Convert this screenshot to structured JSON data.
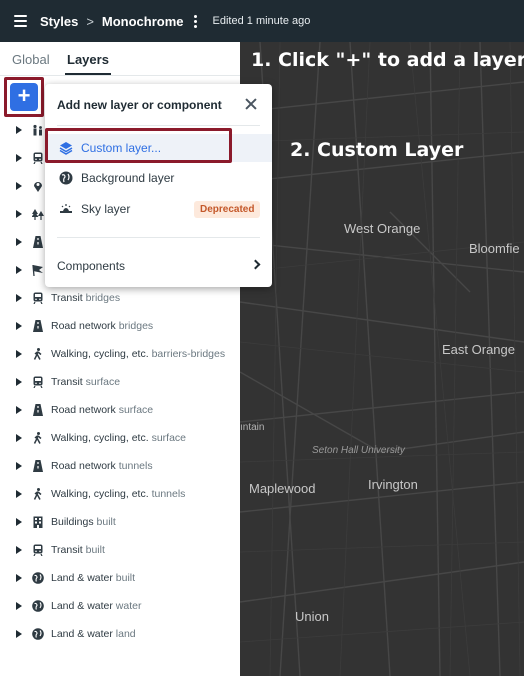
{
  "header": {
    "breadcrumb_root": "Styles",
    "breadcrumb_separator": ">",
    "style_name": "Monochrome",
    "edited_status": "Edited 1 minute ago"
  },
  "tabs": [
    {
      "label": "Global",
      "active": false
    },
    {
      "label": "Layers",
      "active": true
    }
  ],
  "add_button_label": "+",
  "layers": [
    {
      "name": "",
      "suffix": "",
      "icon": "people-icon"
    },
    {
      "name": "",
      "suffix": "",
      "icon": "transit-icon"
    },
    {
      "name": "",
      "suffix": "",
      "icon": "pin-icon"
    },
    {
      "name": "",
      "suffix": "",
      "icon": "trees-icon"
    },
    {
      "name": "",
      "suffix": "",
      "icon": "road-icon"
    },
    {
      "name": "",
      "suffix": "",
      "icon": "flag-icon"
    },
    {
      "name": "Transit",
      "suffix": "bridges",
      "icon": "transit-icon"
    },
    {
      "name": "Road network",
      "suffix": "bridges",
      "icon": "road-icon"
    },
    {
      "name": "Walking, cycling, etc.",
      "suffix": "barriers-bridges",
      "icon": "walking-icon"
    },
    {
      "name": "Transit",
      "suffix": "surface",
      "icon": "transit-icon"
    },
    {
      "name": "Road network",
      "suffix": "surface",
      "icon": "road-icon"
    },
    {
      "name": "Walking, cycling, etc.",
      "suffix": "surface",
      "icon": "walking-icon"
    },
    {
      "name": "Road network",
      "suffix": "tunnels",
      "icon": "road-icon"
    },
    {
      "name": "Walking, cycling, etc.",
      "suffix": "tunnels",
      "icon": "walking-icon"
    },
    {
      "name": "Buildings",
      "suffix": "built",
      "icon": "building-icon"
    },
    {
      "name": "Transit",
      "suffix": "built",
      "icon": "transit-icon"
    },
    {
      "name": "Land & water",
      "suffix": "built",
      "icon": "globe-icon"
    },
    {
      "name": "Land & water",
      "suffix": "water",
      "icon": "globe-icon"
    },
    {
      "name": "Land & water",
      "suffix": "land",
      "icon": "globe-icon"
    }
  ],
  "dropdown": {
    "title": "Add new layer or component",
    "items": [
      {
        "label": "Custom layer...",
        "icon": "layers-icon",
        "selected": true
      },
      {
        "label": "Background layer",
        "icon": "globe-icon",
        "selected": false
      },
      {
        "label": "Sky layer",
        "icon": "sky-icon",
        "selected": false,
        "badge": "Deprecated"
      }
    ],
    "components_label": "Components"
  },
  "map_labels": {
    "west_orange": "West Orange",
    "bloomfield": "Bloomfie",
    "east_orange": "East Orange",
    "seton_hall": "Seton Hall University",
    "mountain": "ıntain",
    "maplewood": "Maplewood",
    "irvington": "Irvington",
    "union": "Union"
  },
  "annotations": {
    "step1": "1. Click \"+\" to add a layer",
    "step2": "2. Custom Layer"
  },
  "colors": {
    "header_bg": "#1f2b33",
    "accent": "#2f6fe3",
    "highlight_border": "#8b1a2b",
    "map_bg": "#333333",
    "badge_bg": "#fde9dc",
    "badge_text": "#c4582a"
  }
}
